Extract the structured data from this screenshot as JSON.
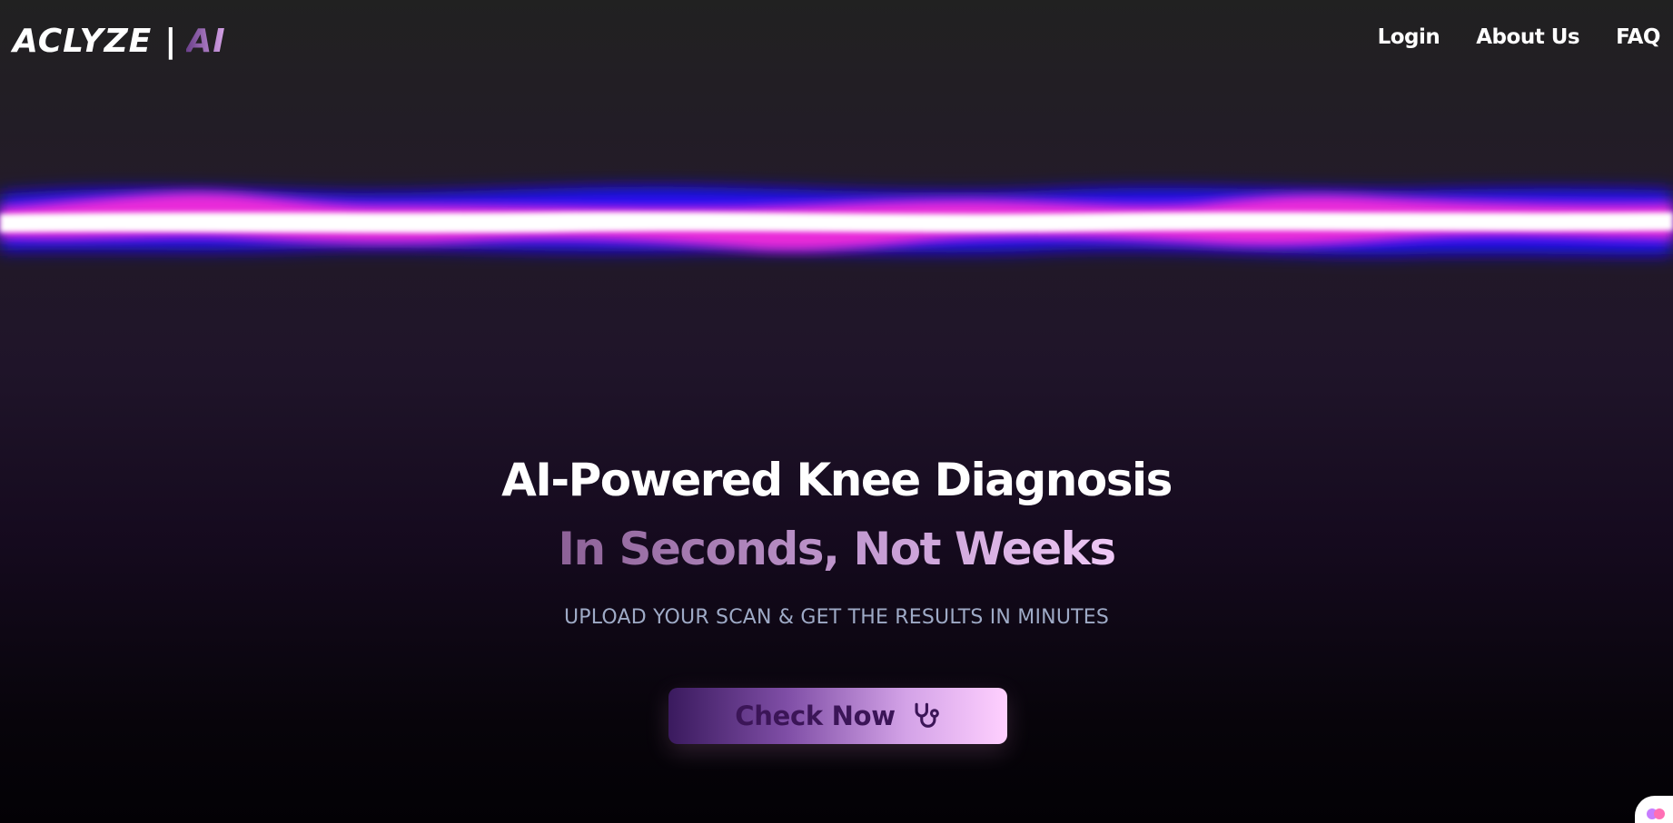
{
  "header": {
    "logo": {
      "brand": "ACLYZE",
      "separator": "|",
      "suffix": "AI"
    },
    "nav": [
      {
        "label": "Login"
      },
      {
        "label": "About Us"
      },
      {
        "label": "FAQ"
      }
    ]
  },
  "hero": {
    "title": "AI-Powered Knee Diagnosis",
    "subtitle": "In Seconds, Not Weeks",
    "tagline": "UPLOAD YOUR SCAN & GET THE RESULTS IN MINUTES",
    "cta": {
      "label": "Check Now",
      "icon": "stethoscope-icon"
    }
  },
  "decor": {
    "waveform": "audio-waveform",
    "corner_widget_icon": "brain-icon"
  },
  "colors": {
    "background_top": "#212121",
    "background_bottom": "#030105",
    "wave_blue": "#1a0fff",
    "wave_magenta": "#ff2bd6",
    "wave_core": "#ffffff",
    "accent_light": "#ffd0ff",
    "accent_dark": "#3a1a5e",
    "tagline": "#9eaac6"
  }
}
